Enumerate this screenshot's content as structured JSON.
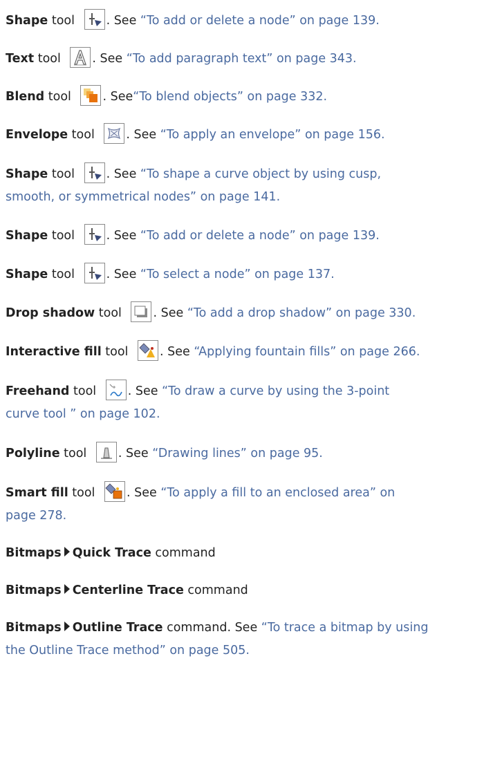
{
  "entries": [
    {
      "tool": "Shape",
      "suffix": " tool",
      "icon": "shape-tool-icon",
      "see": ". See ",
      "link": "“To add or delete a node” on page 139."
    },
    {
      "tool": "Text",
      "suffix": " tool",
      "icon": "text-tool-icon",
      "see": ". See ",
      "link": "“To add paragraph text” on page 343."
    },
    {
      "tool": "Blend",
      "suffix": " tool",
      "icon": "blend-tool-icon",
      "see": ". See",
      "link": "“To blend objects” on page 332."
    },
    {
      "tool": "Envelope",
      "suffix": " tool",
      "icon": "envelope-tool-icon",
      "see": ". See ",
      "link": "“To apply an envelope” on page 156."
    },
    {
      "tool": "Shape",
      "suffix": " tool",
      "icon": "shape-tool-icon",
      "see": ". See ",
      "link": "“To shape a curve object by using cusp,",
      "link2": "smooth, or symmetrical nodes” on page 141."
    },
    {
      "tool": "Shape",
      "suffix": " tool",
      "icon": "shape-tool-icon",
      "see": ". See ",
      "link": "“To add or delete a node” on page 139."
    },
    {
      "tool": "Shape",
      "suffix": " tool",
      "icon": "shape-tool-icon",
      "see": ". See ",
      "link": "“To select a node” on page 137."
    },
    {
      "tool": "Drop shadow",
      "suffix": " tool",
      "icon": "drop-shadow-tool-icon",
      "see": ". See ",
      "link": "“To add a drop shadow” on page 330."
    },
    {
      "tool": "Interactive fill",
      "suffix": " tool",
      "icon": "interactive-fill-tool-icon",
      "see": ". See ",
      "link": "“Applying fountain fills” on page 266."
    },
    {
      "tool": "Freehand",
      "suffix": " tool",
      "icon": "freehand-tool-icon",
      "see": ". See ",
      "link": "“To draw a curve by using the 3-point",
      "link2": "curve tool ” on page 102."
    },
    {
      "tool": "Polyline",
      "suffix": " tool",
      "icon": "polyline-tool-icon",
      "see": ". See ",
      "link": "“Drawing lines” on page 95."
    },
    {
      "tool": "Smart fill",
      "suffix": " tool",
      "icon": "smart-fill-tool-icon",
      "see": ". See ",
      "link": "“To apply a fill to an enclosed area” on",
      "link2": "page 278."
    }
  ],
  "menus": [
    {
      "menu": "Bitmaps",
      "command": "Quick Trace",
      "suffix": " command"
    },
    {
      "menu": "Bitmaps",
      "command": "Centerline Trace",
      "suffix": " command"
    },
    {
      "menu": "Bitmaps",
      "command": "Outline Trace",
      "suffix": " command. See ",
      "link": "“To trace a bitmap by using",
      "link2": "the Outline Trace method” on page 505."
    }
  ],
  "colors": {
    "link": "#4a6aa0",
    "text": "#222222",
    "icon_border": "#8a8a8a"
  }
}
